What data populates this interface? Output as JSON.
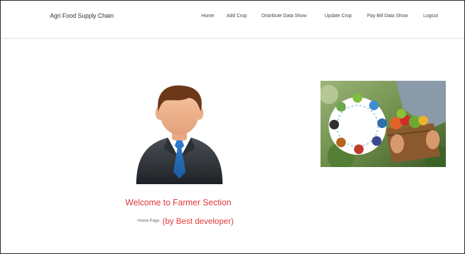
{
  "navbar": {
    "brand": "Agri Food Supply Chain",
    "items": [
      {
        "id": "home",
        "label": "Home"
      },
      {
        "id": "add-crop",
        "label": "Add Crop"
      },
      {
        "id": "distribute",
        "label": "Distribute Data Show"
      },
      {
        "id": "update-crop",
        "label": "Update Crop"
      },
      {
        "id": "pay-bill",
        "label": "Pay Bill Data Show"
      },
      {
        "id": "logout",
        "label": "Logout"
      }
    ]
  },
  "main": {
    "welcome": "Welcome to Farmer Section",
    "home_label": "Home Page",
    "developer": "(by Best developer)"
  },
  "colors": {
    "accent_red": "#e23838",
    "text_dark": "#333333"
  }
}
